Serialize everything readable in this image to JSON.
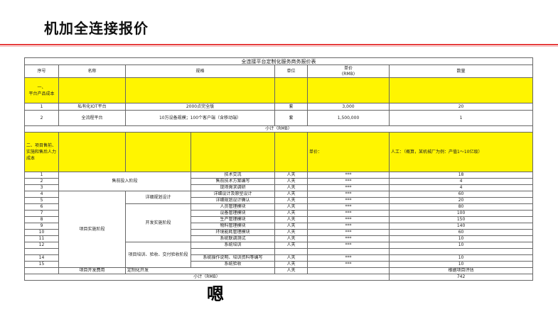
{
  "page": {
    "title": "机加全连接报价",
    "table_title": "全连接平台定制化服务商务报价表",
    "overlay_char": "嗯"
  },
  "headers": {
    "seq": "序号",
    "name": "名称",
    "spec": "规格",
    "unit": "单位",
    "price": "单价\n(RMB)",
    "qty": "数量"
  },
  "section1": {
    "label": "一、\n平台产品成本",
    "rows": [
      {
        "seq": "1",
        "name": "私有化IOT平台",
        "spec": "2000点完全版",
        "unit": "套",
        "price": "3,000",
        "qty": "20"
      },
      {
        "seq": "2",
        "name": "全流程平台",
        "spec": "10万设备规模；100个客户端（含移动端）",
        "unit": "套",
        "price": "1,500,000",
        "qty": "1"
      }
    ],
    "subtotal": "小计（RMB）"
  },
  "section2": {
    "label": "二、项目售前、实施和售后人力成本",
    "price_label": "单价：",
    "qty_label": "人工：（概算，某机械厂为例：产值1～10亿级）",
    "phase_presale": "售前投入阶段",
    "phase_impl": "项目实施阶段",
    "sub_detail": "详细规划设计",
    "sub_dev": "开发实施阶段",
    "sub_train": "项目培训、验收、交付验收阶段",
    "rows": [
      {
        "seq": "1",
        "spec": "技术交流",
        "unit": "人天",
        "price": "***",
        "qty": "18"
      },
      {
        "seq": "2",
        "spec": "售前技术方案编写",
        "unit": "人天",
        "price": "***",
        "qty": "4"
      },
      {
        "seq": "3",
        "spec": "现场需求调研",
        "unit": "人天",
        "price": "***",
        "qty": "4"
      },
      {
        "seq": "4",
        "spec": "详细设计及原型设计",
        "unit": "人天",
        "price": "***",
        "qty": "60"
      },
      {
        "seq": "5",
        "spec": "详细规划设计确认",
        "unit": "人天",
        "price": "***",
        "qty": "20"
      },
      {
        "seq": "6",
        "spec": "人员管理模块",
        "unit": "人天",
        "price": "***",
        "qty": "80"
      },
      {
        "seq": "7",
        "spec": "设备管理模块",
        "unit": "人天",
        "price": "***",
        "qty": "100"
      },
      {
        "seq": "8",
        "spec": "生产管理模块",
        "unit": "人天",
        "price": "***",
        "qty": "150"
      },
      {
        "seq": "9",
        "spec": "物料管理模块",
        "unit": "人天",
        "price": "***",
        "qty": "140"
      },
      {
        "seq": "10",
        "spec": "环境能耗管理模块",
        "unit": "人天",
        "price": "***",
        "qty": "60"
      },
      {
        "seq": "11",
        "spec": "系统联调测试",
        "unit": "人天",
        "price": "***",
        "qty": "10"
      },
      {
        "seq": "12",
        "spec": "系统培训",
        "unit": "人天",
        "price": "***",
        "qty": "10"
      },
      {
        "seq": "14",
        "spec": "系统操作说明、培训资料等编写",
        "unit": "人天",
        "price": "***",
        "qty": "10"
      },
      {
        "seq": "15",
        "spec": "系统验收",
        "unit": "人天",
        "price": "***",
        "qty": "10"
      }
    ],
    "dev_fee_row": {
      "name": "项目开发费用",
      "spec": "定制化开发",
      "unit": "人天",
      "qty": "根据项目评估"
    },
    "subtotal": "小计（RMB）",
    "subtotal_qty": "742"
  },
  "colors": {
    "highlight": "#fff500",
    "rule": "#e63b3b"
  }
}
